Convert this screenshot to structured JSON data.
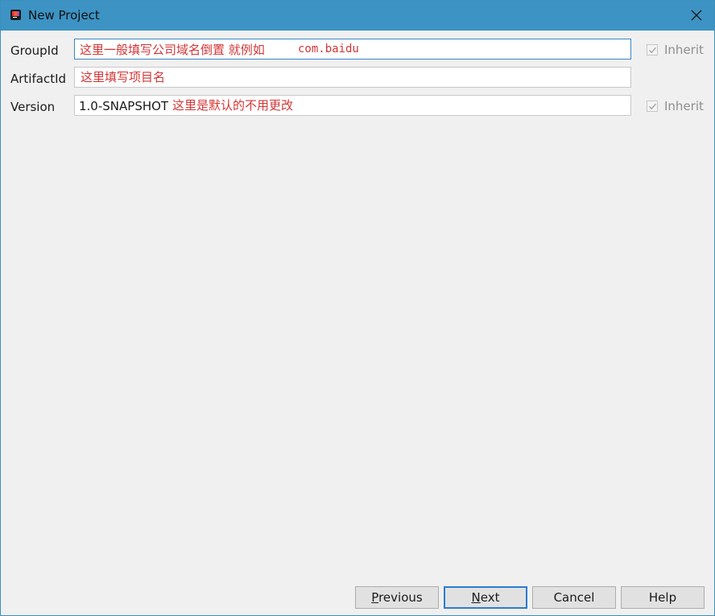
{
  "window": {
    "title": "New Project"
  },
  "title_icons": {
    "app": "intellij-idea-icon",
    "close": "close-icon"
  },
  "fields": {
    "group_id": {
      "label": "GroupId",
      "value": "",
      "annotation": "这里一般填写公司域名倒置 就例如",
      "annotation_code": "com.baidu",
      "inherit_label": "Inherit",
      "inherit_checked": true
    },
    "artifact_id": {
      "label": "ArtifactId",
      "value": "",
      "annotation": "这里填写项目名"
    },
    "version": {
      "label": "Version",
      "value": "1.0-SNAPSHOT",
      "annotation": "这里是默认的不用更改",
      "inherit_label": "Inherit",
      "inherit_checked": true
    }
  },
  "buttons": {
    "previous": "Previous",
    "next": "Next",
    "cancel": "Cancel",
    "help": "Help"
  },
  "colors": {
    "titlebar": "#3d93c3",
    "annotation": "#d43535",
    "focus_border": "#3a86c8"
  }
}
